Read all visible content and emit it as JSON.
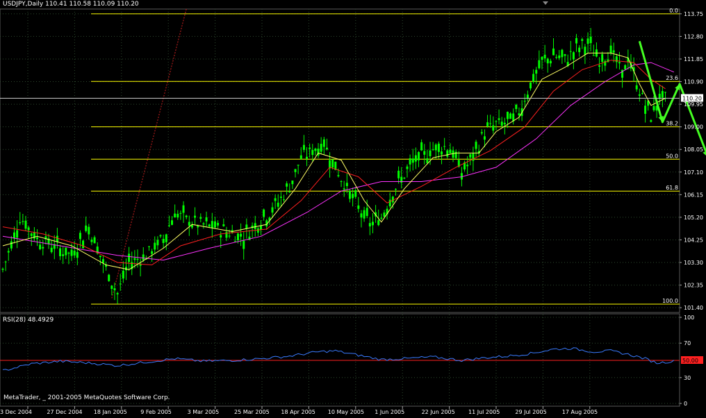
{
  "header": {
    "symbol_info": "USDJPY,Daily  110.41 110.58 110.09 110.20"
  },
  "indicator": {
    "label": "RSI(28) 48.4929",
    "level_value": "50.00"
  },
  "footer": {
    "copyright": "MetaTrader, _ 2001-2005 MetaQuotes Software Corp."
  },
  "colors": {
    "background": "#000000",
    "grid": "#2e4a2e",
    "bull_bar": "#00ff00",
    "fib_line": "#ffff00",
    "ma_fast": "#ffff66",
    "ma_mid": "#ff2020",
    "ma_slow": "#ff33ff",
    "rsi_line": "#3a7bff",
    "rsi_level": "#ff2020",
    "arrow": "#44ff22",
    "current_price_box": "#ffffff"
  },
  "chart_data": [
    {
      "type": "candlestick",
      "title": "USDJPY,Daily",
      "current_price": 110.2,
      "ylim": [
        101.2,
        113.95
      ],
      "y_ticks": [
        "113.75",
        "112.80",
        "111.85",
        "110.90",
        "109.95",
        "109.00",
        "108.05",
        "107.10",
        "106.15",
        "105.20",
        "104.25",
        "103.30",
        "102.35",
        "101.40"
      ],
      "x_ticks": [
        "3 Dec 2004",
        "27 Dec 2004",
        "18 Jan 2005",
        "9 Feb 2005",
        "3 Mar 2005",
        "25 Mar 2005",
        "18 Apr 2005",
        "10 May 2005",
        "1 Jun 2005",
        "22 Jun 2005",
        "11 Jul 2005",
        "29 Jul 2005",
        "17 Aug 2005"
      ],
      "fibonacci_levels": [
        {
          "label": "0.0",
          "price": 113.75
        },
        {
          "label": "23.6",
          "price": 110.91
        },
        {
          "label": "38.2",
          "price": 109.0
        },
        {
          "label": "50.0",
          "price": 107.64
        },
        {
          "label": "61.8",
          "price": 106.3
        },
        {
          "label": "100.0",
          "price": 101.55
        }
      ],
      "close_path": [
        [
          0,
          103.0
        ],
        [
          6,
          105.2
        ],
        [
          12,
          104.3
        ],
        [
          18,
          104.0
        ],
        [
          24,
          103.6
        ],
        [
          30,
          104.8
        ],
        [
          36,
          103.0
        ],
        [
          40,
          102.0
        ],
        [
          44,
          103.3
        ],
        [
          50,
          103.6
        ],
        [
          56,
          104.3
        ],
        [
          60,
          105.4
        ],
        [
          64,
          105.1
        ],
        [
          68,
          104.9
        ],
        [
          74,
          104.8
        ],
        [
          80,
          104.5
        ],
        [
          84,
          104.4
        ],
        [
          88,
          104.9
        ],
        [
          94,
          105.5
        ],
        [
          100,
          106.5
        ],
        [
          104,
          107.7
        ],
        [
          108,
          108.0
        ],
        [
          112,
          108.3
        ],
        [
          116,
          107.3
        ],
        [
          120,
          106.4
        ],
        [
          124,
          105.6
        ],
        [
          128,
          104.9
        ],
        [
          132,
          105.2
        ],
        [
          136,
          106.3
        ],
        [
          140,
          107.0
        ],
        [
          144,
          107.6
        ],
        [
          148,
          107.9
        ],
        [
          152,
          108.2
        ],
        [
          156,
          108.1
        ],
        [
          160,
          107.1
        ],
        [
          164,
          107.7
        ],
        [
          168,
          108.8
        ],
        [
          172,
          109.1
        ],
        [
          176,
          109.2
        ],
        [
          180,
          109.6
        ],
        [
          184,
          110.8
        ],
        [
          188,
          111.7
        ],
        [
          192,
          112.0
        ],
        [
          196,
          111.8
        ],
        [
          200,
          112.3
        ],
        [
          204,
          112.5
        ],
        [
          208,
          111.8
        ],
        [
          212,
          112.2
        ],
        [
          216,
          111.2
        ],
        [
          218,
          111.9
        ],
        [
          221,
          110.8
        ],
        [
          223,
          110.2
        ],
        [
          226,
          109.4
        ],
        [
          229,
          110.3
        ],
        [
          231,
          110.2
        ]
      ],
      "ma_fast_path": [
        [
          0,
          104.0
        ],
        [
          12,
          104.4
        ],
        [
          24,
          104.0
        ],
        [
          36,
          103.2
        ],
        [
          44,
          103.0
        ],
        [
          56,
          103.9
        ],
        [
          66,
          104.9
        ],
        [
          80,
          104.6
        ],
        [
          92,
          104.9
        ],
        [
          102,
          106.4
        ],
        [
          110,
          107.9
        ],
        [
          118,
          107.6
        ],
        [
          126,
          105.9
        ],
        [
          132,
          105.0
        ],
        [
          140,
          106.4
        ],
        [
          150,
          107.7
        ],
        [
          158,
          107.9
        ],
        [
          166,
          107.9
        ],
        [
          172,
          108.8
        ],
        [
          180,
          109.4
        ],
        [
          188,
          111.0
        ],
        [
          196,
          111.5
        ],
        [
          204,
          112.1
        ],
        [
          212,
          112.1
        ],
        [
          218,
          111.9
        ],
        [
          222,
          110.8
        ],
        [
          226,
          109.9
        ],
        [
          231,
          110.2
        ]
      ],
      "ma_mid_path": [
        [
          0,
          104.8
        ],
        [
          14,
          104.5
        ],
        [
          28,
          104.0
        ],
        [
          40,
          103.3
        ],
        [
          52,
          103.2
        ],
        [
          62,
          104.0
        ],
        [
          76,
          104.5
        ],
        [
          92,
          104.7
        ],
        [
          104,
          105.9
        ],
        [
          114,
          107.3
        ],
        [
          124,
          106.9
        ],
        [
          134,
          105.8
        ],
        [
          146,
          106.5
        ],
        [
          158,
          107.3
        ],
        [
          170,
          108.0
        ],
        [
          182,
          109.0
        ],
        [
          192,
          110.5
        ],
        [
          202,
          111.4
        ],
        [
          212,
          111.8
        ],
        [
          220,
          111.7
        ],
        [
          226,
          111.0
        ],
        [
          231,
          110.6
        ]
      ],
      "ma_slow_path": [
        [
          0,
          104.4
        ],
        [
          20,
          104.0
        ],
        [
          40,
          103.6
        ],
        [
          56,
          103.4
        ],
        [
          72,
          103.9
        ],
        [
          90,
          104.4
        ],
        [
          106,
          105.4
        ],
        [
          118,
          106.3
        ],
        [
          132,
          106.7
        ],
        [
          146,
          106.7
        ],
        [
          160,
          106.9
        ],
        [
          172,
          107.3
        ],
        [
          186,
          108.5
        ],
        [
          198,
          109.9
        ],
        [
          210,
          110.9
        ],
        [
          220,
          111.6
        ],
        [
          226,
          111.7
        ],
        [
          234,
          111.3
        ]
      ],
      "trend_line_path": [
        [
          38,
          101.8
        ],
        [
          64,
          113.95
        ]
      ],
      "forecast_arrow_path": [
        [
          222,
          112.6
        ],
        [
          230,
          109.2
        ],
        [
          236,
          110.8
        ],
        [
          246,
          107.7
        ]
      ]
    },
    {
      "type": "line",
      "title": "RSI(28)",
      "ylim": [
        0,
        100
      ],
      "y_ticks": [
        "100",
        "70",
        "50",
        "30",
        "0"
      ],
      "level": 50,
      "series_path": [
        [
          0,
          38
        ],
        [
          10,
          46
        ],
        [
          20,
          49
        ],
        [
          30,
          47
        ],
        [
          40,
          44
        ],
        [
          50,
          48
        ],
        [
          60,
          52
        ],
        [
          70,
          49
        ],
        [
          80,
          50
        ],
        [
          90,
          52
        ],
        [
          100,
          55
        ],
        [
          110,
          60
        ],
        [
          116,
          61
        ],
        [
          124,
          56
        ],
        [
          132,
          51
        ],
        [
          140,
          52
        ],
        [
          150,
          54
        ],
        [
          160,
          50
        ],
        [
          168,
          53
        ],
        [
          176,
          55
        ],
        [
          184,
          58
        ],
        [
          192,
          63
        ],
        [
          198,
          64
        ],
        [
          206,
          60
        ],
        [
          212,
          61
        ],
        [
          218,
          57
        ],
        [
          224,
          52
        ],
        [
          228,
          47
        ],
        [
          234,
          49
        ]
      ]
    }
  ]
}
